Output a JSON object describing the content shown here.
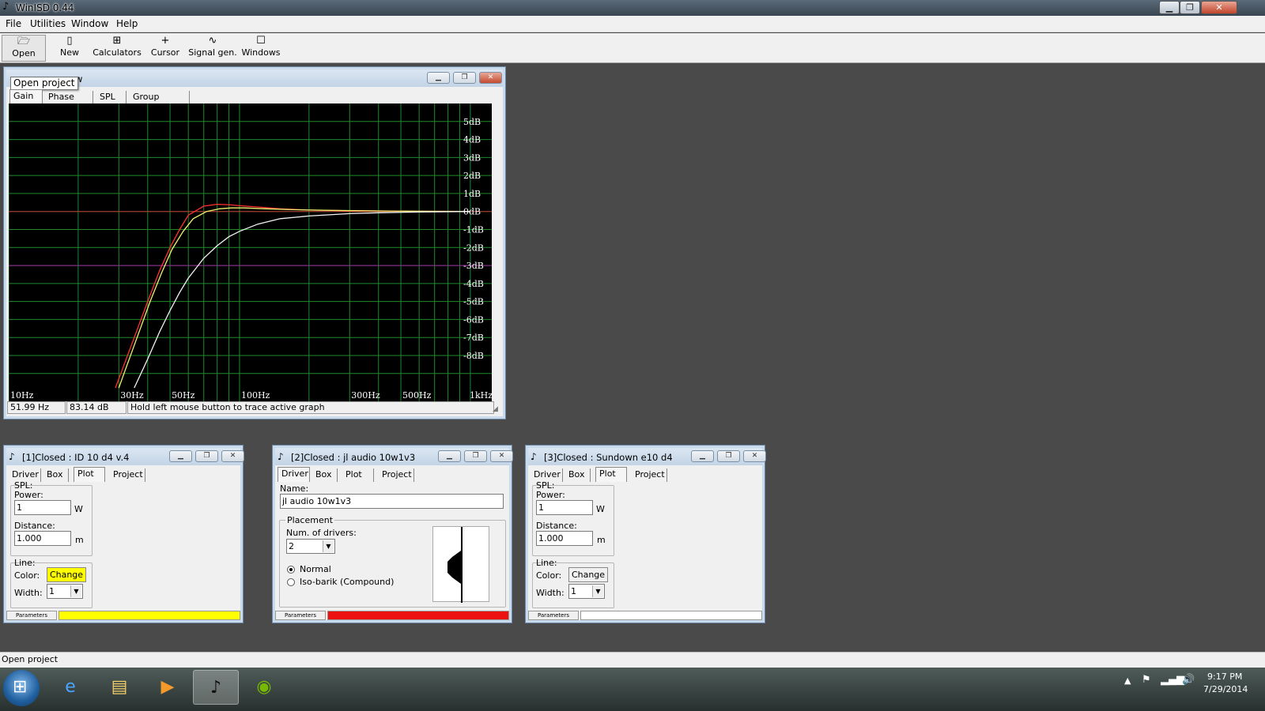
{
  "app": {
    "title": "WinISD 0.44"
  },
  "menu": [
    "File",
    "Utilities",
    "Window",
    "Help"
  ],
  "toolbar": [
    {
      "label": "Open",
      "icon": "open-folder-icon",
      "glyph": "🗁"
    },
    {
      "label": "New",
      "icon": "new-document-icon",
      "glyph": "▯"
    },
    {
      "label": "Calculators",
      "icon": "calculator-icon",
      "glyph": "⊞"
    },
    {
      "label": "Cursor",
      "icon": "cursor-icon",
      "glyph": "+"
    },
    {
      "label": "Signal gen.",
      "icon": "signal-generator-icon",
      "glyph": "∿"
    },
    {
      "label": "Windows",
      "icon": "windows-icon",
      "glyph": "☐"
    }
  ],
  "graph_window": {
    "title_partial": "ow",
    "tooltip": "Open project",
    "tabs": [
      "Gain",
      "Phase plot",
      "SPL",
      "Group delay"
    ],
    "status": {
      "freq": "51.99 Hz",
      "level": "83.14 dB",
      "hint": "Hold left mouse button to trace active graph"
    }
  },
  "chart_data": {
    "type": "line",
    "title": "",
    "xlabel": "",
    "ylabel": "",
    "x_scale": "log",
    "x_ticks": [
      "10Hz",
      "30Hz",
      "50Hz",
      "100Hz",
      "300Hz",
      "500Hz",
      "1kHz"
    ],
    "x_tick_values": [
      10,
      30,
      50,
      100,
      300,
      500,
      1000
    ],
    "y_ticks": [
      "5dB",
      "4dB",
      "3dB",
      "2dB",
      "1dB",
      "0dB",
      "-1dB",
      "-2dB",
      "-3dB",
      "-4dB",
      "-5dB",
      "-6dB",
      "-7dB",
      "-8dB"
    ],
    "y_tick_values": [
      5,
      4,
      3,
      2,
      1,
      0,
      -1,
      -2,
      -3,
      -4,
      -5,
      -6,
      -7,
      -8
    ],
    "xlim": [
      10,
      1100
    ],
    "ylim": [
      -9.8,
      6
    ],
    "grid": true,
    "reference_lines": [
      {
        "y": 0,
        "color": "#c03030"
      },
      {
        "y": -3,
        "color": "#a020a0"
      }
    ],
    "series": [
      {
        "color": "#ff3030",
        "x": [
          29,
          31,
          35,
          40,
          45,
          50,
          55,
          60,
          70,
          80,
          90,
          100,
          120,
          150,
          200,
          300,
          500,
          1000
        ],
        "y": [
          -9.8,
          -8.8,
          -7.0,
          -5.0,
          -3.3,
          -2.0,
          -1.0,
          -0.2,
          0.3,
          0.4,
          0.38,
          0.32,
          0.25,
          0.15,
          0.08,
          0.04,
          0.02,
          0.0
        ]
      },
      {
        "color": "#f0f070",
        "x": [
          30,
          32,
          36,
          41,
          46,
          51,
          57,
          63,
          72,
          82,
          92,
          105,
          130,
          170,
          250,
          400,
          700,
          1000
        ],
        "y": [
          -9.8,
          -8.8,
          -7.0,
          -5.0,
          -3.4,
          -2.1,
          -1.1,
          -0.4,
          0.0,
          0.15,
          0.2,
          0.2,
          0.15,
          0.1,
          0.06,
          0.03,
          0.01,
          0.0
        ]
      },
      {
        "color": "#f4f4f4",
        "x": [
          35,
          40,
          45,
          50,
          55,
          60,
          70,
          80,
          90,
          100,
          120,
          150,
          200,
          300,
          400,
          600,
          1000
        ],
        "y": [
          -9.8,
          -8.2,
          -6.7,
          -5.5,
          -4.5,
          -3.7,
          -2.6,
          -1.9,
          -1.4,
          -1.1,
          -0.7,
          -0.4,
          -0.25,
          -0.12,
          -0.07,
          -0.03,
          0.0
        ]
      }
    ]
  },
  "driver_windows": [
    {
      "title": "[1]Closed : ID 10 d4 v.4",
      "tabs": [
        "Driver",
        "Box",
        "Plot",
        "Project"
      ],
      "active_tab": "Plot",
      "spl_label": "SPL:",
      "power_label": "Power:",
      "power_value": "1",
      "power_unit": "W",
      "distance_label": "Distance:",
      "distance_value": "1.000",
      "distance_unit": "m",
      "line_label": "Line:",
      "color_label": "Color:",
      "change_label": "Change",
      "width_label": "Width:",
      "width_value": "1",
      "parameters_label": "Parameters",
      "line_color": "#ffff00"
    },
    {
      "title": "[3]Closed : Sundown e10 d4",
      "tabs": [
        "Driver",
        "Box",
        "Plot",
        "Project"
      ],
      "active_tab": "Plot",
      "spl_label": "SPL:",
      "power_label": "Power:",
      "power_value": "1",
      "power_unit": "W",
      "distance_label": "Distance:",
      "distance_value": "1.000",
      "distance_unit": "m",
      "line_label": "Line:",
      "color_label": "Color:",
      "change_label": "Change",
      "width_label": "Width:",
      "width_value": "1",
      "parameters_label": "Parameters",
      "line_color": "#ffffff"
    }
  ],
  "jl_window": {
    "title": "[2]Closed : jl audio 10w1v3",
    "tabs": [
      "Driver",
      "Box",
      "Plot",
      "Project"
    ],
    "active_tab": "Driver",
    "name_label": "Name:",
    "name_value": "jl audio 10w1v3",
    "placement_label": "Placement",
    "num_drivers_label": "Num. of drivers:",
    "num_drivers_value": "2",
    "radio_normal": "Normal",
    "radio_isobarik": "Iso-barik (Compound)",
    "parameters_label": "Parameters",
    "line_color": "#ee1111"
  },
  "status_bar": {
    "text": "Open project"
  },
  "taskbar": {
    "time": "9:17 PM",
    "date": "7/29/2014"
  }
}
